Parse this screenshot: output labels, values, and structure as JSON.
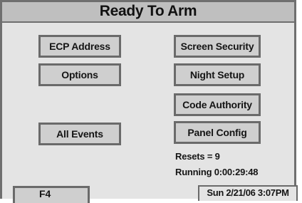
{
  "header": {
    "title": "Ready To Arm"
  },
  "buttons": {
    "ecp_address": "ECP Address",
    "options": "Options",
    "all_events": "All Events",
    "screen_security": "Screen Security",
    "night_setup": "Night Setup",
    "code_authority": "Code Authority",
    "panel_config": "Panel Config"
  },
  "status": {
    "resets": "Resets = 9",
    "running": "Running 0:00:29:48"
  },
  "footer": {
    "function_key": "F4",
    "datetime": "Sun 2/21/06 3:07PM"
  },
  "colors": {
    "panel_background": "#e4e4e4",
    "title_background": "#bfbfbf",
    "button_background": "#cfcfcf",
    "border": "#6a6a6a"
  }
}
